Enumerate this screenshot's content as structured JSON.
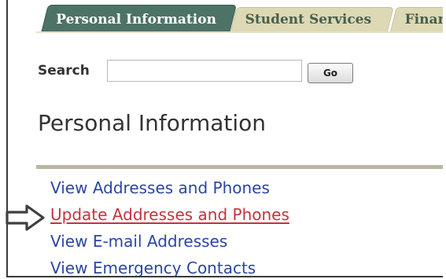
{
  "tabs": [
    {
      "label": "Personal Information",
      "active": true
    },
    {
      "label": "Student Services",
      "active": false
    },
    {
      "label": "Financ",
      "active": false
    }
  ],
  "search": {
    "label": "Search",
    "value": "",
    "placeholder": "",
    "button_label": "Go"
  },
  "page": {
    "title": "Personal Information"
  },
  "menu": {
    "links": [
      {
        "label": "View Addresses and Phones"
      },
      {
        "label": "Update Addresses and Phones",
        "state": "hover"
      },
      {
        "label": "View E-mail Addresses"
      },
      {
        "label": "View Emergency Contacts"
      }
    ]
  },
  "annotation": {
    "icon": "right-arrow-icon"
  },
  "colors": {
    "active_tab": "#4d7266",
    "inactive_tab": "#ddd9b5",
    "link": "#2a46a3",
    "link_hover": "#c2343d",
    "divider": "#b9b6a1"
  }
}
